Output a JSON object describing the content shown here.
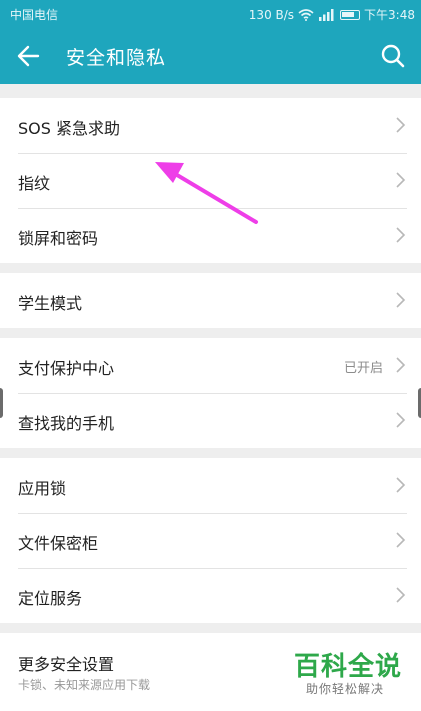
{
  "status_bar": {
    "carrier": "中国电信",
    "speed": "130 B/s",
    "signal_icons": [
      "wifi-icon",
      "signal-icon",
      "battery-icon"
    ],
    "time": "下午3:48"
  },
  "app_bar": {
    "title": "安全和隐私",
    "back_icon": "back-arrow-icon",
    "search_icon": "search-icon",
    "color": "#1ea6bd"
  },
  "groups": [
    {
      "items": [
        {
          "label": "SOS 紧急求助"
        },
        {
          "label": "指纹"
        },
        {
          "label": "锁屏和密码"
        }
      ]
    },
    {
      "items": [
        {
          "label": "学生模式"
        }
      ]
    },
    {
      "items": [
        {
          "label": "支付保护中心",
          "value": "已开启"
        },
        {
          "label": "查找我的手机"
        }
      ]
    },
    {
      "items": [
        {
          "label": "应用锁"
        },
        {
          "label": "文件保密柜"
        },
        {
          "label": "定位服务"
        }
      ]
    },
    {
      "items": [
        {
          "label": "更多安全设置",
          "sub": "卡锁、未知来源应用下载"
        }
      ]
    }
  ],
  "annotation": {
    "arrow_color": "#ee3ee8"
  },
  "watermark": {
    "title": "百科全说",
    "subtitle": "助你轻松解决",
    "color": "#2ea84a"
  }
}
